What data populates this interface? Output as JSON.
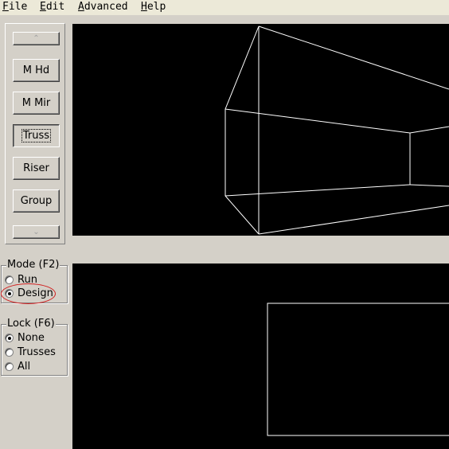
{
  "menubar": {
    "items": [
      {
        "accel": "F",
        "rest": "ile"
      },
      {
        "accel": "E",
        "rest": "dit"
      },
      {
        "accel": "A",
        "rest": "dvanced"
      },
      {
        "accel": "H",
        "rest": "elp"
      }
    ]
  },
  "toolbar": {
    "scroll_up_icon": "chevron-up-icon",
    "scroll_down_icon": "chevron-down-icon",
    "buttons": [
      {
        "label": "M Hd",
        "pressed": false
      },
      {
        "label": "M Mir",
        "pressed": false
      },
      {
        "label": "Truss",
        "pressed": true
      },
      {
        "label": "Riser",
        "pressed": false
      },
      {
        "label": "Group",
        "pressed": false
      }
    ]
  },
  "mode_group": {
    "title": "Mode (F2)",
    "options": [
      {
        "label": "Run",
        "selected": false
      },
      {
        "label": "Design",
        "selected": true
      }
    ],
    "highlight_color": "#d02020"
  },
  "lock_group": {
    "title": "Lock (F6)",
    "options": [
      {
        "label": "None",
        "selected": true
      },
      {
        "label": "Trusses",
        "selected": false
      },
      {
        "label": "All",
        "selected": false
      }
    ]
  },
  "viewports": {
    "background": "#000000",
    "line_color": "#ffffff"
  }
}
